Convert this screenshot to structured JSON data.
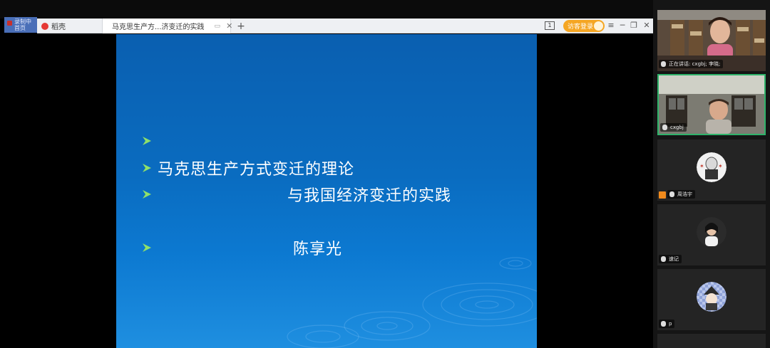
{
  "recording": {
    "label": "录制中\n首页"
  },
  "browser": {
    "home_tab": {
      "label": "稻壳",
      "icon": "docer-icon"
    },
    "active_tab": {
      "title": "马克思生产方...济变迁的实践",
      "icon": "ppt-file-icon"
    },
    "new_tab_label": "+",
    "tab_count": "1",
    "login_button": "访客登录",
    "window_controls": {
      "menu": "≡",
      "minimize": "─",
      "maximize": "❐",
      "close": "✕"
    }
  },
  "slide": {
    "lines": [
      {
        "text": ""
      },
      {
        "text": "马克思生产方式变迁的理论"
      },
      {
        "text": "与我国经济变迁的实践"
      },
      {
        "text": "陈享光"
      }
    ],
    "colors": {
      "bullet": "#8fe06a",
      "text": "#ffffff"
    }
  },
  "participants": [
    {
      "name": "正在讲话: cxgbj; 李晓;",
      "type": "video"
    },
    {
      "name": "cxgbj",
      "type": "video",
      "speaking": true
    },
    {
      "name": "周浩宇",
      "type": "avatar",
      "host": true
    },
    {
      "name": "速记",
      "type": "avatar"
    },
    {
      "name": "p",
      "type": "avatar"
    },
    {
      "name": "",
      "type": "avatar"
    }
  ]
}
